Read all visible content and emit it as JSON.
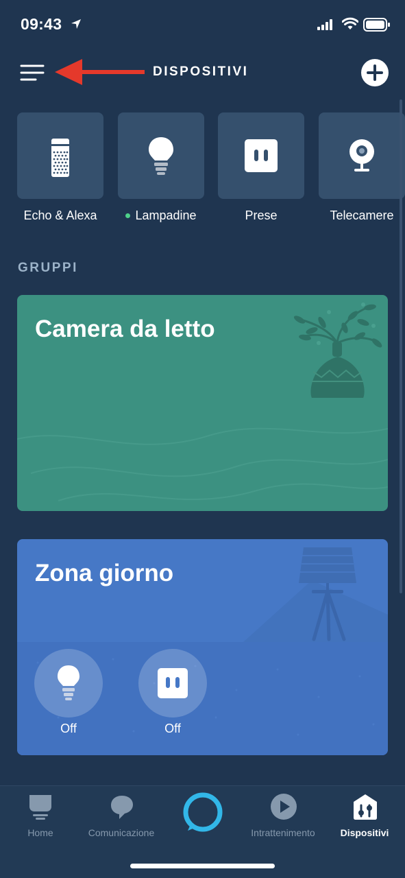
{
  "status_bar": {
    "time": "09:43",
    "icons": [
      "location-arrow-icon",
      "cellular-signal-icon",
      "wifi-icon",
      "battery-icon"
    ]
  },
  "header": {
    "title": "DISPOSITIVI",
    "menu_icon": "hamburger-menu-icon",
    "annotation_icon": "red-arrow-icon",
    "add_icon": "plus-icon"
  },
  "categories": [
    {
      "label": "Echo & Alexa",
      "icon": "echo-speaker-icon",
      "active_dot": false
    },
    {
      "label": "Lampadine",
      "icon": "light-bulb-icon",
      "active_dot": true
    },
    {
      "label": "Prese",
      "icon": "plug-icon",
      "active_dot": false
    },
    {
      "label": "Telecamere",
      "icon": "camera-icon",
      "active_dot": false
    }
  ],
  "groups": {
    "heading": "GRUPPI",
    "items": [
      {
        "name": "Camera da letto",
        "color": "#3c9181",
        "art": "plant-vase-illustration"
      },
      {
        "name": "Zona giorno",
        "color": "#4678c6",
        "art": "floor-lamp-illustration",
        "controls": [
          {
            "icon": "light-bulb-icon",
            "state": "Off"
          },
          {
            "icon": "plug-icon",
            "state": "Off"
          }
        ]
      }
    ]
  },
  "bottom_nav": [
    {
      "label": "Home",
      "icon": "home-icon",
      "active": false
    },
    {
      "label": "Comunicazione",
      "icon": "chat-bubble-icon",
      "active": false
    },
    {
      "label": "",
      "icon": "alexa-ring-icon",
      "active": false
    },
    {
      "label": "Intrattenimento",
      "icon": "play-icon",
      "active": false
    },
    {
      "label": "Dispositivi",
      "icon": "devices-icon",
      "active": true
    }
  ],
  "colors": {
    "background": "#1f3550",
    "tile": "#35506d",
    "accent_alexa": "#32b7e8",
    "green_dot": "#4ed18a",
    "annotation_red": "#e5392b"
  }
}
